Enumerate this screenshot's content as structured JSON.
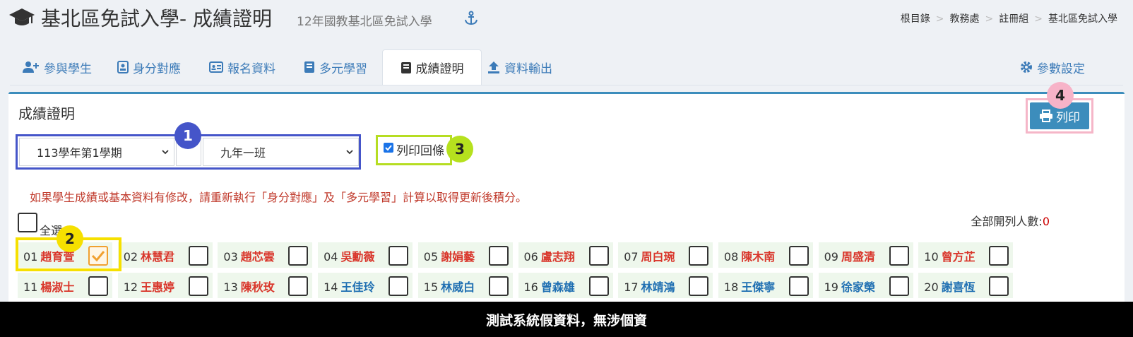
{
  "header": {
    "title": "基北區免試入學- 成績證明",
    "subtitle": "12年國教基北區免試入學",
    "breadcrumb": [
      "根目錄",
      "教務處",
      "註冊組",
      "基北區免試入學"
    ]
  },
  "tabs": [
    {
      "label": "參與學生",
      "icon": "user-plus-icon"
    },
    {
      "label": "身分對應",
      "icon": "id-badge-icon"
    },
    {
      "label": "報名資料",
      "icon": "id-card-icon"
    },
    {
      "label": "多元學習",
      "icon": "book-icon"
    },
    {
      "label": "成績證明",
      "icon": "book-icon",
      "active": true
    },
    {
      "label": "資料輸出",
      "icon": "upload-icon"
    }
  ],
  "settings_label": "參數設定",
  "panel": {
    "title": "成績證明",
    "print_label": "列印",
    "semester_select": "113學年第1學期",
    "class_select": "九年一班",
    "print_receipt_label": "列印回條",
    "print_receipt_checked": true,
    "warning": "如果學生成績或基本資料有修改，請重新執行「身分對應」及「多元學習」計算以取得更新後積分。",
    "select_all_label": "全選",
    "count_label": "全部開列人數:",
    "count_value": "0"
  },
  "badges": [
    "1",
    "2",
    "3",
    "4"
  ],
  "students_row1": [
    {
      "no": "01",
      "name": "趙育萱",
      "checked": true
    },
    {
      "no": "02",
      "name": "林慧君"
    },
    {
      "no": "03",
      "name": "趙芯雲"
    },
    {
      "no": "04",
      "name": "吳勳薇"
    },
    {
      "no": "05",
      "name": "謝娟藝"
    },
    {
      "no": "06",
      "name": "盧志翔"
    },
    {
      "no": "07",
      "name": "周白琬"
    },
    {
      "no": "08",
      "name": "陳木南"
    },
    {
      "no": "09",
      "name": "周盛清"
    },
    {
      "no": "10",
      "name": "曾方芷"
    }
  ],
  "students_row2": [
    {
      "no": "11",
      "name": "楊淑士"
    },
    {
      "no": "12",
      "name": "王惠婷"
    },
    {
      "no": "13",
      "name": "陳秋玫"
    },
    {
      "no": "14",
      "name": "王佳玲"
    },
    {
      "no": "15",
      "name": "林威白"
    },
    {
      "no": "16",
      "name": "曾森雄"
    },
    {
      "no": "17",
      "name": "林靖鴻"
    },
    {
      "no": "18",
      "name": "王傑寧"
    },
    {
      "no": "19",
      "name": "徐家榮"
    },
    {
      "no": "20",
      "name": "謝喜恆"
    }
  ],
  "colors": {
    "female": "#d9362b",
    "male": "#1f6fb2",
    "accent": "#3c8dbc"
  },
  "footer": "測試系統假資料，無涉個資"
}
